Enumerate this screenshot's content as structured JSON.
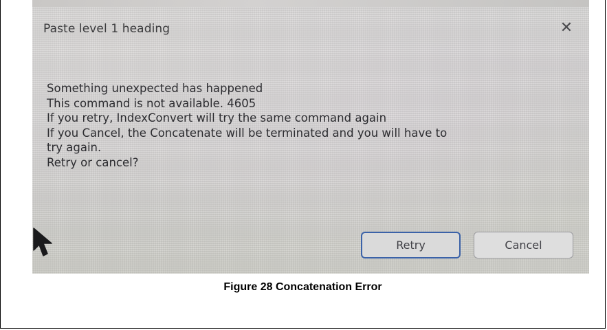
{
  "dialog": {
    "title": "Paste level 1 heading",
    "close_glyph": "✕",
    "message_lines": [
      "Something unexpected has happened",
      "This command is not available. 4605",
      "If you retry, IndexConvert will try the same command again",
      "If you Cancel, the Concatenate will be terminated and you will have to",
      "try again.",
      "Retry or cancel?"
    ],
    "buttons": {
      "retry_label": "Retry",
      "cancel_label": "Cancel"
    }
  },
  "caption": "Figure 28 Concatenation Error",
  "icons": {
    "close": "close-icon",
    "cursor": "mouse-pointer-icon"
  },
  "colors": {
    "retry_border": "#3b62a8",
    "dialog_background": "#d3d2d2"
  }
}
